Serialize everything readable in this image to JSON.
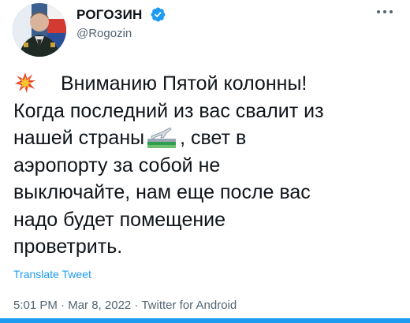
{
  "profile": {
    "display_name": "РОГОЗИН",
    "handle": "@Rogozin"
  },
  "icons": {
    "verified": "verified-badge-icon",
    "more": "more-options-icon",
    "burst": "collision-emoji-icon",
    "departure": "airplane-departure-emoji-icon"
  },
  "tweet": {
    "line1": "Вниманию Пятой колонны!",
    "line2": "Когда последний из вас свалит из",
    "line3_a": "нашей страны",
    "line3_b": ", свет в",
    "line4": "аэропорту за собой не",
    "line5": "выключайте, нам еще после вас",
    "line6": "надо будет помещение",
    "line7": "проветрить."
  },
  "translate_label": "Translate Tweet",
  "meta": {
    "time": "5:01 PM",
    "sep1": " · ",
    "date": "Mar 8, 2022",
    "sep2": " · ",
    "source": "Twitter for Android"
  },
  "colors": {
    "accent": "#1d9bf0",
    "secondary_text": "#536471",
    "primary_text": "#0f1419"
  }
}
